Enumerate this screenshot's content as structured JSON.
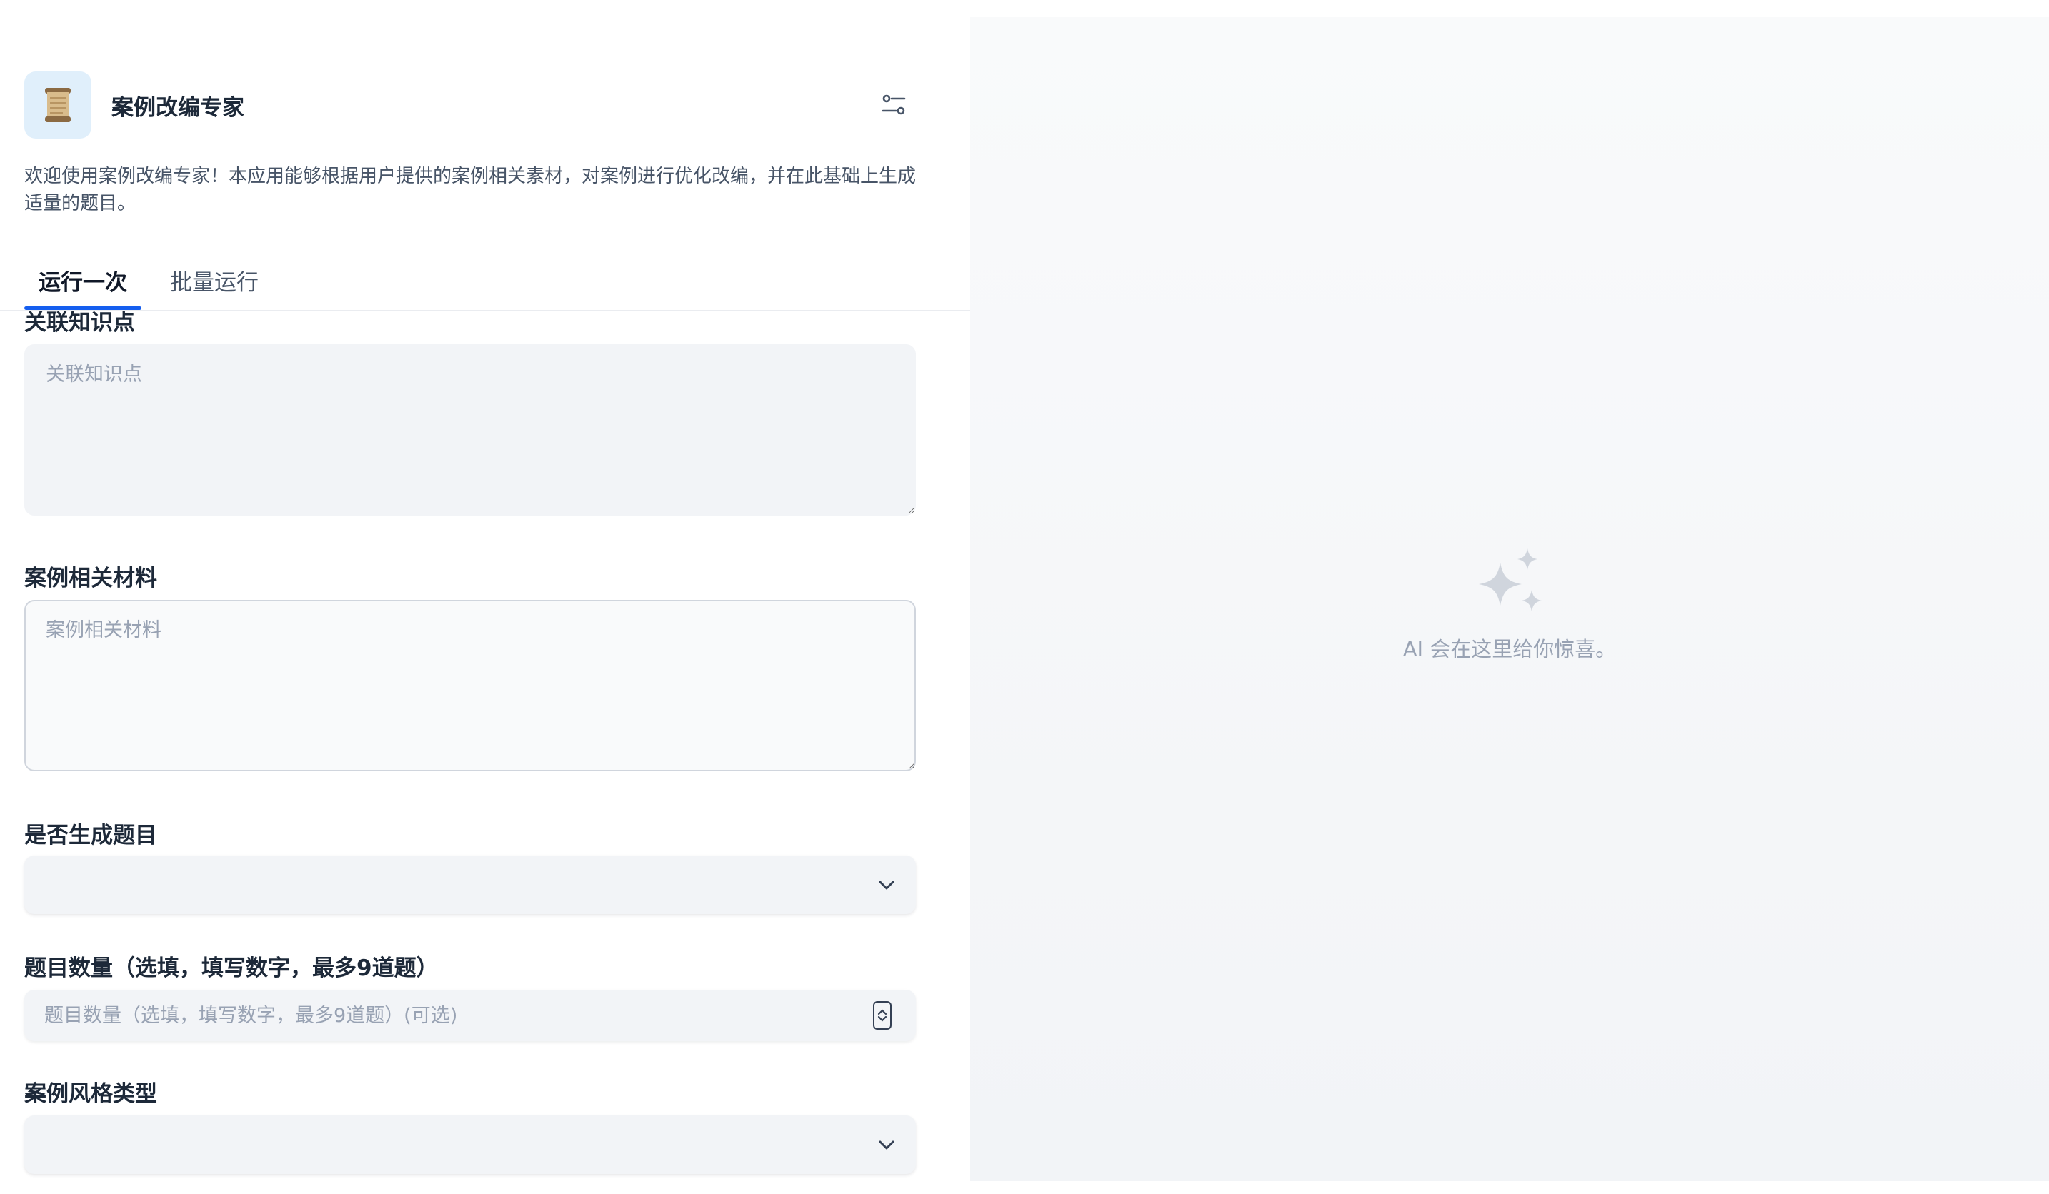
{
  "app": {
    "title": "案例改编专家",
    "description": "欢迎使用案例改编专家！本应用能够根据用户提供的案例相关素材，对案例进行优化改编，并在此基础上生成适量的题目。",
    "icon": "scroll-icon"
  },
  "tabs": [
    {
      "label": "运行一次",
      "active": true
    },
    {
      "label": "批量运行",
      "active": false
    }
  ],
  "form": {
    "knowledge": {
      "label": "关联知识点",
      "placeholder": "关联知识点",
      "value": ""
    },
    "material": {
      "label": "案例相关材料",
      "placeholder": "案例相关材料",
      "value": ""
    },
    "generate_questions": {
      "label": "是否生成题目",
      "value": ""
    },
    "question_count": {
      "label": "题目数量（选填，填写数字，最多9道题）",
      "placeholder": "题目数量（选填，填写数字，最多9道题）(可选)",
      "value": ""
    },
    "style": {
      "label": "案例风格类型",
      "value": ""
    }
  },
  "output": {
    "empty_text": "AI 会在这里给你惊喜。",
    "icon": "sparkles-icon"
  },
  "colors": {
    "accent": "#155eef",
    "input_bg": "#f2f4f7",
    "muted_text": "#98a2b3",
    "panel_bg": "#f5f6f8"
  }
}
